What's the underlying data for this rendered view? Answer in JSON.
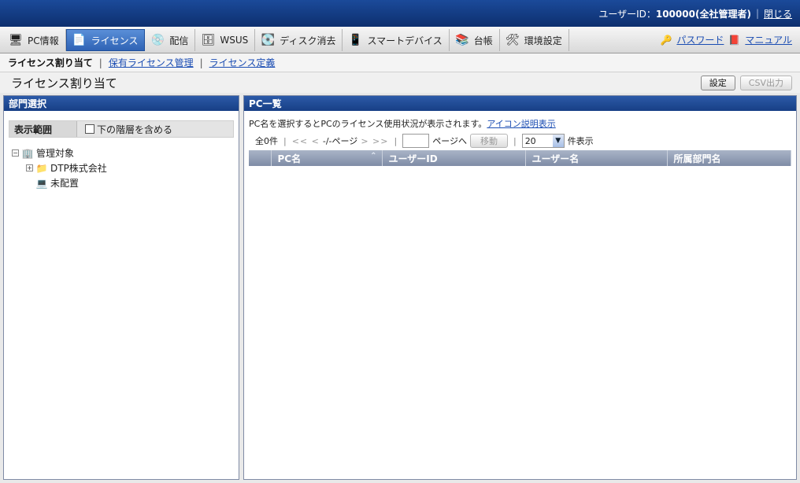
{
  "header": {
    "user_label": "ユーザーID：",
    "user_value": "100000(全社管理者)",
    "close_link": "閉じる"
  },
  "tabs": [
    {
      "label": "PC情報",
      "icon": "pc-icon",
      "active": false
    },
    {
      "label": "ライセンス",
      "icon": "license-icon",
      "active": true
    },
    {
      "label": "配信",
      "icon": "delivery-icon",
      "active": false
    },
    {
      "label": "WSUS",
      "icon": "wsus-server-icon",
      "active": false
    },
    {
      "label": "ディスク消去",
      "icon": "disk-erase-icon",
      "active": false
    },
    {
      "label": "スマートデバイス",
      "icon": "smart-device-icon",
      "active": false
    },
    {
      "label": "台帳",
      "icon": "ledger-icon",
      "active": false
    },
    {
      "label": "環境設定",
      "icon": "tools-icon",
      "active": false
    }
  ],
  "toplinks": {
    "password": "パスワード",
    "manual": "マニュアル"
  },
  "subnav": {
    "current": "ライセンス割り当て",
    "link1": "保有ライセンス管理",
    "link2": "ライセンス定義"
  },
  "page": {
    "title": "ライセンス割り当て",
    "settings_button": "設定",
    "csv_button": "CSV出力"
  },
  "left_panel": {
    "title": "部門選択",
    "scope_label": "表示範囲",
    "include_sub_label": "下の階層を含める",
    "tree": {
      "root": "管理対象",
      "child": "DTP株式会社",
      "unassigned": "未配置"
    }
  },
  "right_panel": {
    "title": "PC一覧",
    "description": "PC名を選択するとPCのライセンス使用状況が表示されます。",
    "icon_help_link": "アイコン説明表示",
    "pager": {
      "total": "全0件",
      "nav_prev": "<< <",
      "page_info": "-/-ページ",
      "nav_next": "> >>",
      "goto_label": "ページへ",
      "move_button": "移動",
      "per_page_value": "20",
      "per_page_label": "件表示"
    },
    "columns": [
      "PC名",
      "ユーザーID",
      "ユーザー名",
      "所属部門名"
    ]
  }
}
